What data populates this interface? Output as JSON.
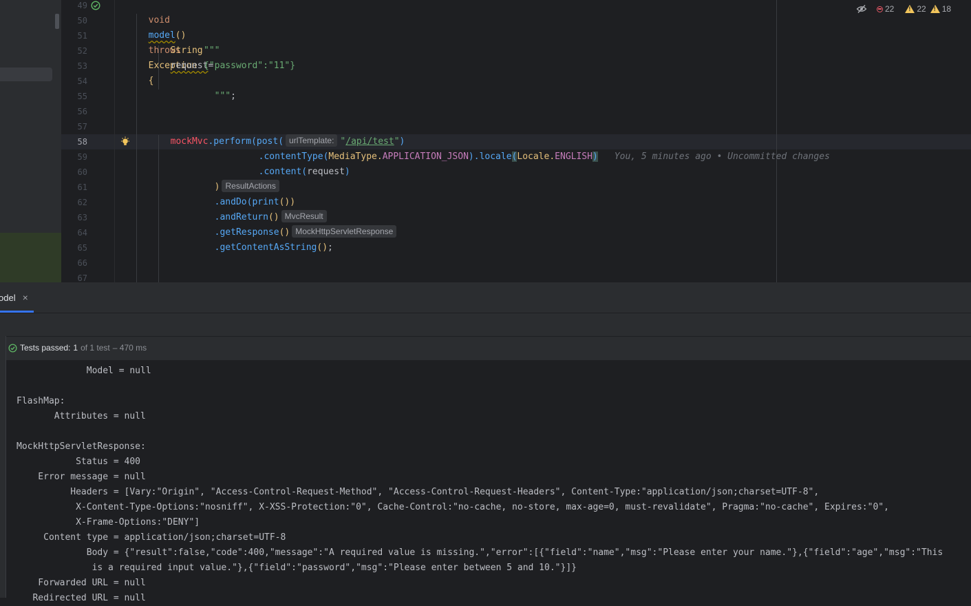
{
  "editor": {
    "lines": [
      {
        "n": "49"
      },
      {
        "n": "50"
      },
      {
        "n": "51"
      },
      {
        "n": "52"
      },
      {
        "n": "53"
      },
      {
        "n": "54"
      },
      {
        "n": "55"
      },
      {
        "n": "56"
      },
      {
        "n": "57"
      },
      {
        "n": "58",
        "active": true
      },
      {
        "n": "59"
      },
      {
        "n": "60"
      },
      {
        "n": "61"
      },
      {
        "n": "62"
      },
      {
        "n": "63"
      },
      {
        "n": "64"
      },
      {
        "n": "65"
      },
      {
        "n": "66"
      },
      {
        "n": "67"
      }
    ],
    "code": {
      "l49_void": "void",
      "l49_model": "model",
      "l49_parens": "()",
      "l49_throws": "throws",
      "l49_exception": "Exception",
      "l49_brace": "{",
      "l51_type": "String",
      "l51_var": "request",
      "l51_eq": "=",
      "l52": "\"\"\"",
      "l53": "{\"password\":\"11\"}",
      "l54_quotes": "\"\"\"",
      "l54_semi": ";",
      "l57_mock": "mockMvc",
      "l57_perform": ".perform(",
      "l57_post": "post(",
      "l57_hint": "urlTemplate:",
      "l57_str_open": "\"",
      "l57_url": "/api/test",
      "l57_str_close": "\"",
      "l57_close": ")",
      "l58_ct": ".contentType(",
      "l58_mt": "MediaType.",
      "l58_const": "APPLICATION_JSON",
      "l58_close": ")",
      "l58_locale": ".locale",
      "l58_open": "(",
      "l58_loc": "Locale.",
      "l58_eng": "ENGLISH",
      "l58_close2": ")",
      "l58_blame": "You, 5 minutes ago • Uncommitted changes",
      "l59_content": ".content(",
      "l59_arg": "request",
      "l59_close": ")",
      "l60_close": ")",
      "l60_hint": "ResultActions",
      "l61_and": ".andDo(",
      "l61_print": "print",
      "l61_close": "())",
      "l62_ret": ".andReturn",
      "l62_parens": "()",
      "l62_hint": "MvcResult",
      "l63_resp": ".getResponse",
      "l63_parens": "()",
      "l63_hint": "MockHttpServletResponse",
      "l64_get": ".getContentAsString",
      "l64_parens": "()",
      "l64_semi": ";"
    },
    "inspections": {
      "errors": "22",
      "warnings": "22",
      "weak_warnings": "18"
    }
  },
  "tool_window": {
    "tab_label": "odel",
    "tab_close": "×",
    "status_prefix": "Tests passed:",
    "status_count": "1",
    "status_of": "of 1 test",
    "status_time": "– 470 ms",
    "console_lines": [
      "             Model = null",
      "",
      "FlashMap:",
      "       Attributes = null",
      "",
      "MockHttpServletResponse:",
      "           Status = 400",
      "    Error message = null",
      "          Headers = [Vary:\"Origin\", \"Access-Control-Request-Method\", \"Access-Control-Request-Headers\", Content-Type:\"application/json;charset=UTF-8\",",
      "           X-Content-Type-Options:\"nosniff\", X-XSS-Protection:\"0\", Cache-Control:\"no-cache, no-store, max-age=0, must-revalidate\", Pragma:\"no-cache\", Expires:\"0\",",
      "           X-Frame-Options:\"DENY\"]",
      "     Content type = application/json;charset=UTF-8",
      "             Body = {\"result\":false,\"code\":400,\"message\":\"A required value is missing.\",\"error\":[{\"field\":\"name\",\"msg\":\"Please enter your name.\"},{\"field\":\"age\",\"msg\":\"This",
      "              is a required input value.\"},{\"field\":\"password\",\"msg\":\"Please enter between 5 and 10.\"}]}",
      "    Forwarded URL = null",
      "   Redirected URL = null"
    ]
  },
  "colors": {
    "accent": "#3574f0",
    "success": "#5fb865",
    "error": "#e55765",
    "warning": "#f2c55c"
  },
  "icons": {
    "gutter_test": "check-circle-icon",
    "gutter_intention": "lightbulb-icon",
    "inspection_toggle": "eye-crossed-icon"
  }
}
